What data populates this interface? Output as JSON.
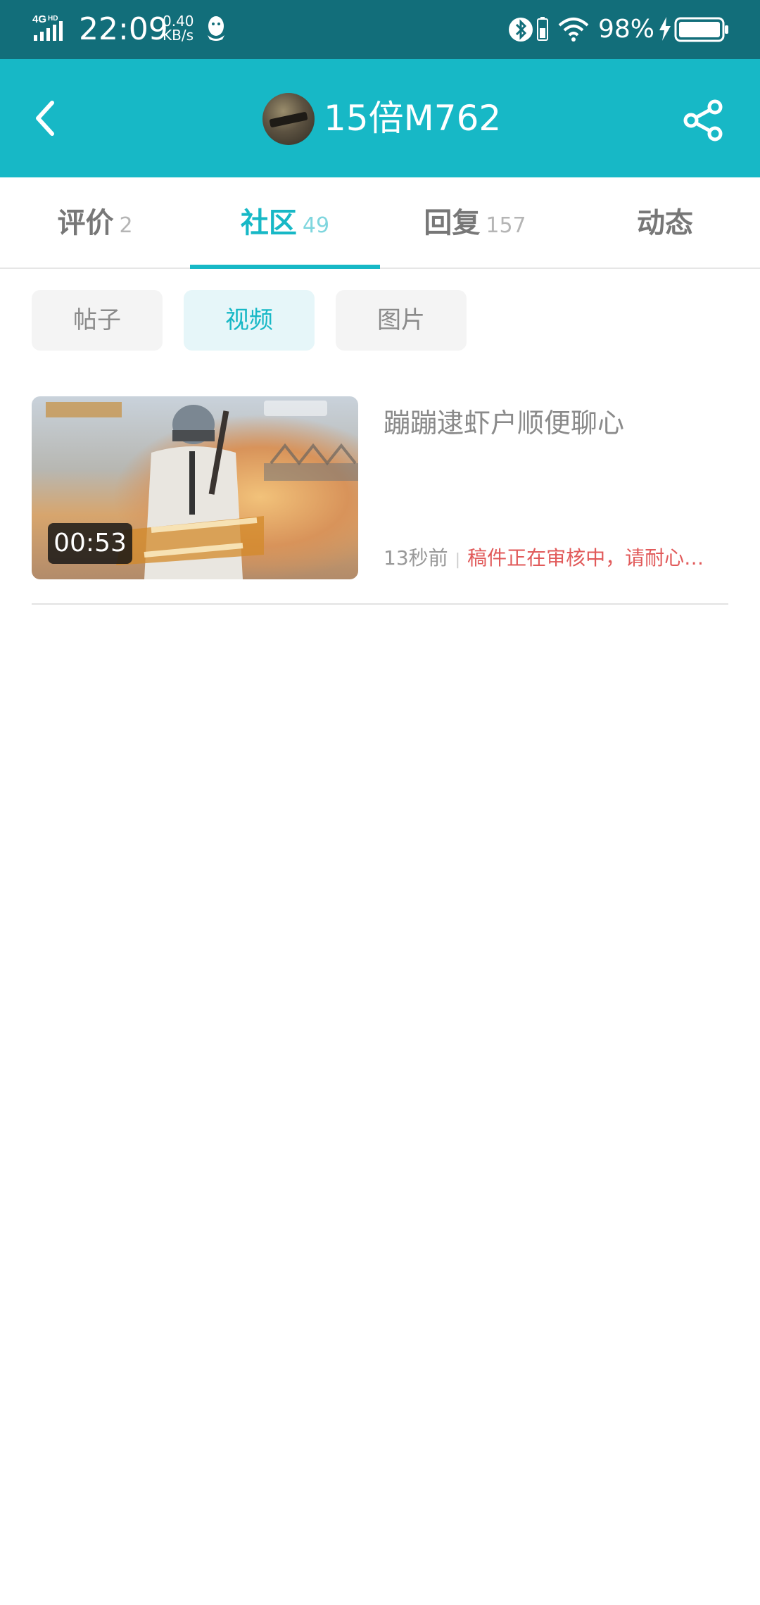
{
  "status_bar": {
    "network": "4G HD",
    "time": "22:09",
    "speed_value": "0.40",
    "speed_unit": "KB/s",
    "battery_pct": "98%",
    "icons": [
      "signal-icon",
      "qq-icon",
      "bluetooth-icon",
      "wifi-icon",
      "charging-icon",
      "battery-icon"
    ]
  },
  "header": {
    "title": "15倍M762",
    "icons": [
      "back-arrow-icon",
      "share-icon"
    ]
  },
  "tabs": [
    {
      "label": "评价",
      "count": "2"
    },
    {
      "label": "社区",
      "count": "49",
      "active": true
    },
    {
      "label": "回复",
      "count": "157"
    },
    {
      "label": "动态",
      "count": ""
    }
  ],
  "filters": [
    {
      "label": "帖子"
    },
    {
      "label": "视频",
      "active": true
    },
    {
      "label": "图片"
    }
  ],
  "videos": [
    {
      "duration": "00:53",
      "title": "蹦蹦逮虾户顺便聊心",
      "time_ago": "13秒前",
      "status": "稿件正在审核中，请耐心…"
    }
  ],
  "colors": {
    "status_bar": "#126e7a",
    "accent": "#17b8c6",
    "review_status": "#e15a5a"
  }
}
